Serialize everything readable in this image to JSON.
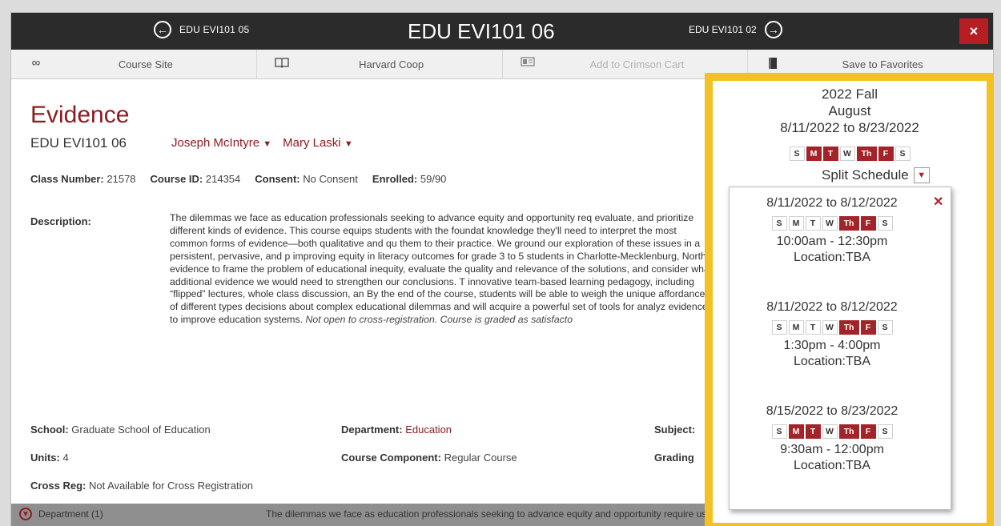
{
  "header": {
    "prev_label": "EDU EVI101 05",
    "title": "EDU EVI101 06",
    "next_label": "EDU EVI101 02",
    "close_symbol": "×"
  },
  "toolbar": [
    {
      "label": "Course Site",
      "icon": "link-icon"
    },
    {
      "label": "Harvard Coop",
      "icon": "book-icon"
    },
    {
      "label": "Add to Crimson Cart",
      "icon": "cart-icon"
    },
    {
      "label": "Save to Favorites",
      "icon": "bookmark-icon"
    }
  ],
  "course": {
    "title": "Evidence",
    "code": "EDU EVI101 06",
    "instructors": [
      "Joseph McIntyre",
      "Mary Laski"
    ],
    "class_number_label": "Class Number:",
    "class_number": "21578",
    "course_id_label": "Course ID:",
    "course_id": "214354",
    "consent_label": "Consent:",
    "consent": "No Consent",
    "enrolled_label": "Enrolled:",
    "enrolled": "59/90",
    "description_label": "Description:",
    "description": "The dilemmas we face as education professionals seeking to advance equity and opportunity req evaluate, and prioritize different kinds of evidence. This course equips students with the foundat knowledge they'll need to interpret the most common forms of evidence—both qualitative and qu them to their practice. We ground our exploration of these issues in a persistent, pervasive, and p improving equity in literacy outcomes for grade 3 to 5 students in Charlotte-Mecklenburg, North evidence to frame the problem of educational inequity, evaluate the quality and relevance of the solutions, and consider what additional evidence we would need to strengthen our conclusions. T innovative team-based learning pedagogy, including “flipped” lectures, whole class discussion, an By the end of the course, students will be able to weigh the unique affordances of different types decisions about complex educational dilemmas and will acquire a powerful set of tools for analyz evidence to improve education systems.",
    "description_italic": "Not open to cross-registration. Course is graded as satisfacto",
    "school_label": "School:",
    "school": "Graduate School of Education",
    "department_label": "Department:",
    "department": "Education",
    "subject_label": "Subject:",
    "units_label": "Units:",
    "units": "4",
    "component_label": "Course Component:",
    "component": "Regular Course",
    "grading_label": "Grading",
    "crossreg_label": "Cross Reg:",
    "crossreg": "Not Available for Cross Registration"
  },
  "bottom": {
    "left": "Department (1)",
    "text": "The dilemmas we face as education professionals seeking to advance equity and opportunity require us"
  },
  "schedule": {
    "term": "2022 Fall",
    "month": "August",
    "range": "8/11/2022 to 8/23/2022",
    "days": [
      {
        "d": "S",
        "on": false
      },
      {
        "d": "M",
        "on": true
      },
      {
        "d": "T",
        "on": true
      },
      {
        "d": "W",
        "on": false
      },
      {
        "d": "Th",
        "on": true
      },
      {
        "d": "F",
        "on": true
      },
      {
        "d": "S",
        "on": false
      }
    ],
    "split_label": "Split Schedule",
    "blocks": [
      {
        "range": "8/11/2022 to 8/12/2022",
        "time": "10:00am - 12:30pm",
        "location": "Location:TBA",
        "days": [
          {
            "d": "S",
            "on": false
          },
          {
            "d": "M",
            "on": false
          },
          {
            "d": "T",
            "on": false
          },
          {
            "d": "W",
            "on": false
          },
          {
            "d": "Th",
            "on": true
          },
          {
            "d": "F",
            "on": true
          },
          {
            "d": "S",
            "on": false
          }
        ]
      },
      {
        "range": "8/11/2022 to 8/12/2022",
        "time": "1:30pm - 4:00pm",
        "location": "Location:TBA",
        "days": [
          {
            "d": "S",
            "on": false
          },
          {
            "d": "M",
            "on": false
          },
          {
            "d": "T",
            "on": false
          },
          {
            "d": "W",
            "on": false
          },
          {
            "d": "Th",
            "on": true
          },
          {
            "d": "F",
            "on": true
          },
          {
            "d": "S",
            "on": false
          }
        ]
      },
      {
        "range": "8/15/2022 to 8/23/2022",
        "time": "9:30am - 12:00pm",
        "location": "Location:TBA",
        "days": [
          {
            "d": "S",
            "on": false
          },
          {
            "d": "M",
            "on": true
          },
          {
            "d": "T",
            "on": true
          },
          {
            "d": "W",
            "on": false
          },
          {
            "d": "Th",
            "on": true
          },
          {
            "d": "F",
            "on": true
          },
          {
            "d": "S",
            "on": false
          }
        ]
      }
    ]
  },
  "colors": {
    "accent": "#8c1d22",
    "day_on": "#a42328",
    "highlight_border": "#f2c224",
    "topbar": "#2b2b2b"
  }
}
